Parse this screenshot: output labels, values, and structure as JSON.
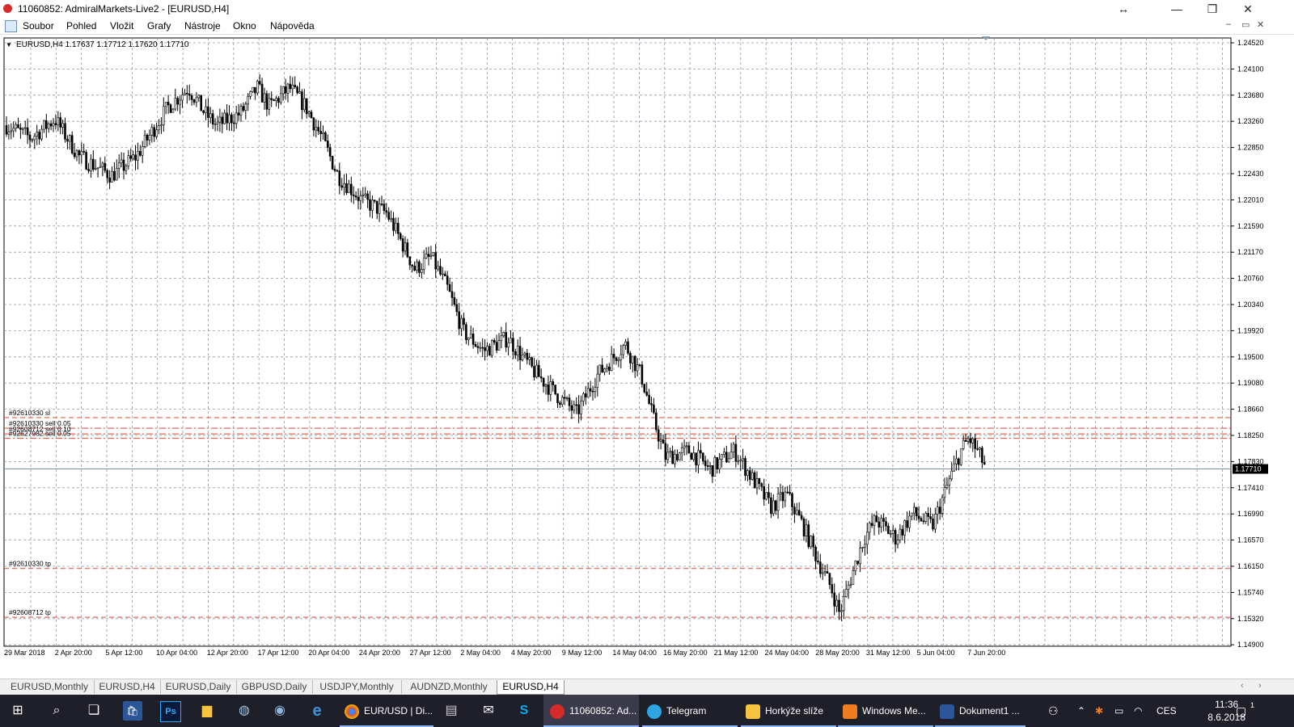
{
  "window": {
    "title": "11060852: AdmiralMarkets-Live2 - [EURUSD,H4]",
    "controls": [
      "↔",
      "—",
      "❐",
      "✕"
    ]
  },
  "menu": {
    "items": [
      "Soubor",
      "Pohled",
      "Vložit",
      "Grafy",
      "Nástroje",
      "Okno",
      "Nápověda"
    ],
    "mdi_controls": [
      "–",
      "▭",
      "✕"
    ]
  },
  "chart": {
    "header": "EURUSD,H4  1.17637 1.17712 1.17620 1.17710",
    "price_axis": [
      "1.24520",
      "1.24100",
      "1.23680",
      "1.23260",
      "1.22850",
      "1.22430",
      "1.22010",
      "1.21590",
      "1.21170",
      "1.20760",
      "1.20340",
      "1.19920",
      "1.19500",
      "1.19080",
      "1.18660",
      "1.18250",
      "1.17830",
      "1.17410",
      "1.16990",
      "1.16570",
      "1.16150",
      "1.15740",
      "1.15320",
      "1.14900"
    ],
    "time_axis": [
      "29 Mar 2018",
      "2 Apr 20:00",
      "5 Apr 12:00",
      "10 Apr 04:00",
      "12 Apr 20:00",
      "17 Apr 12:00",
      "20 Apr 04:00",
      "24 Apr 20:00",
      "27 Apr 12:00",
      "2 May 04:00",
      "4 May 20:00",
      "9 May 12:00",
      "14 May 04:00",
      "16 May 20:00",
      "21 May 12:00",
      "24 May 04:00",
      "28 May 20:00",
      "31 May 12:00",
      "5 Jun 04:00",
      "7 Jun 20:00"
    ],
    "current_price": "1.17710",
    "order_lines": [
      {
        "label": "#92610330 sl",
        "price": 1.1853,
        "style": "dash"
      },
      {
        "label": "#92610330 sell 0.05",
        "price": 1.1836,
        "style": "dashdot"
      },
      {
        "label": "#92608712 sell 0.10",
        "price": 1.1827,
        "style": "dashdot"
      },
      {
        "label": "#92627982 sell 0.05",
        "price": 1.182,
        "style": "dashdot"
      },
      {
        "label": "#92610330 tp",
        "price": 1.1612,
        "style": "dash"
      },
      {
        "label": "#92608712 tp",
        "price": 1.1534,
        "style": "dash"
      }
    ],
    "colors": {
      "order_line": "#e0442c",
      "grid": "#8a9aa8",
      "candle": "#000000",
      "current_line": "#7a8fa3"
    }
  },
  "tabs": {
    "items": [
      "EURUSD,Monthly",
      "EURUSD,H4",
      "EURUSD,Daily",
      "GBPUSD,Daily",
      "USDJPY,Monthly",
      "AUDNZD,Monthly",
      "EURUSD,H4"
    ],
    "active_index": 6
  },
  "taskbar": {
    "tasks": [
      {
        "label": "EUR/USD | Di...",
        "icon": "chrome-icon"
      },
      {
        "label": "11060852: Ad...",
        "icon": "mt4-icon"
      },
      {
        "label": "Telegram",
        "icon": "telegram-icon"
      },
      {
        "label": "Horkýže slíže",
        "icon": "folder-icon"
      },
      {
        "label": "Windows Me...",
        "icon": "media-icon"
      },
      {
        "label": "Dokument1 ...",
        "icon": "word-icon"
      }
    ],
    "lang": "CES",
    "time": "11:36",
    "date": "8.6.2018",
    "notification_count": "1"
  }
}
